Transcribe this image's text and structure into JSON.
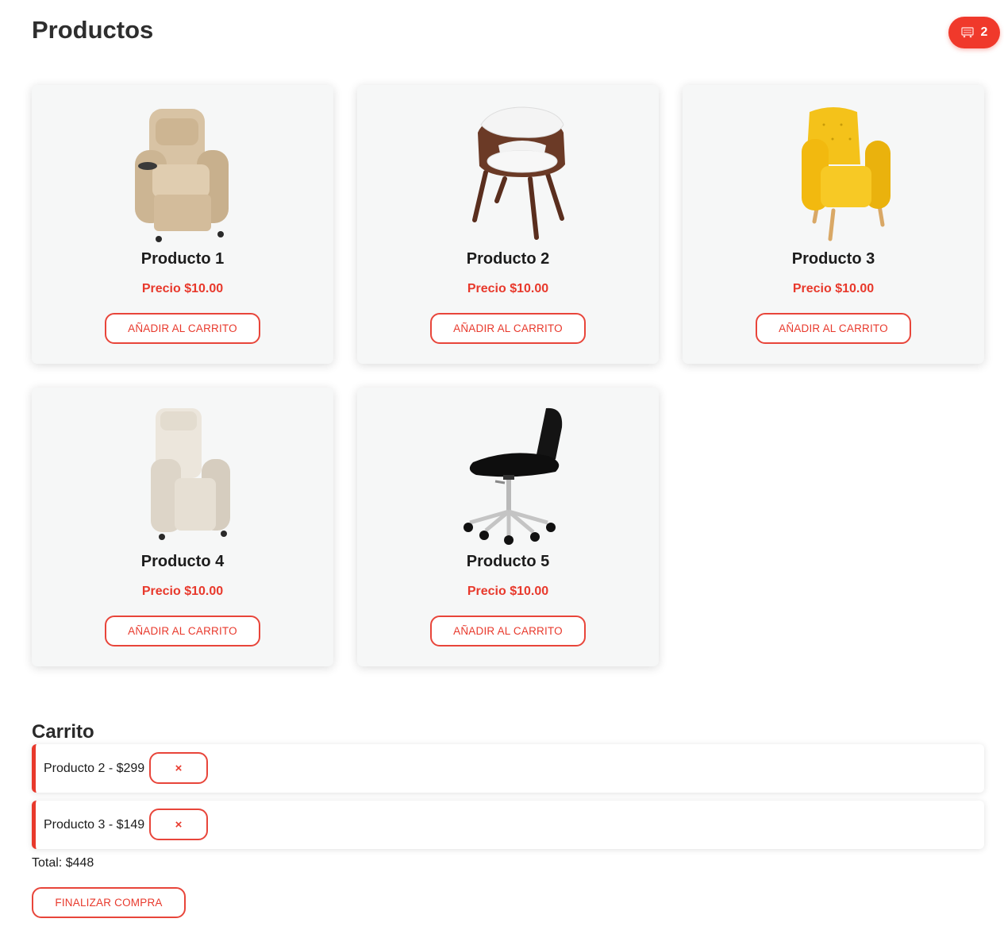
{
  "header": {
    "title": "Productos",
    "cart_count": "2",
    "cart_icon": "shopping-cart-icon"
  },
  "products": [
    {
      "name": "Producto 1",
      "price": "Precio $10.00",
      "button": "AÑADIR AL CARRITO",
      "image": "beige-recliner-armchair"
    },
    {
      "name": "Producto 2",
      "price": "Precio $10.00",
      "button": "AÑADIR AL CARRITO",
      "image": "white-wood-accent-chair"
    },
    {
      "name": "Producto 3",
      "price": "Precio $10.00",
      "button": "AÑADIR AL CARRITO",
      "image": "yellow-armchair"
    },
    {
      "name": "Producto 4",
      "price": "Precio $10.00",
      "button": "AÑADIR AL CARRITO",
      "image": "cream-recliner"
    },
    {
      "name": "Producto 5",
      "price": "Precio $10.00",
      "button": "AÑADIR AL CARRITO",
      "image": "black-swivel-office-chair"
    }
  ],
  "cart": {
    "title": "Carrito",
    "items": [
      {
        "label": "Producto 2 - $299",
        "remove": "×"
      },
      {
        "label": "Producto 3 - $149",
        "remove": "×"
      }
    ],
    "total": "Total: $448",
    "checkout": "FINALIZAR COMPRA"
  },
  "colors": {
    "accent": "#e8392c",
    "card_bg": "#f6f7f7",
    "badge_bg": "#f0392b"
  }
}
